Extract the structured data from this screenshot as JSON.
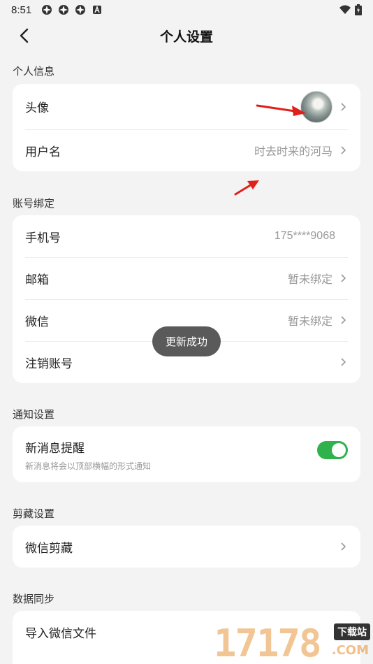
{
  "status_bar": {
    "time": "8:51",
    "icons": [
      "app-icon",
      "app-icon",
      "app-icon",
      "a-icon"
    ],
    "right_icons": [
      "wifi-icon",
      "battery-icon"
    ]
  },
  "nav": {
    "title": "个人设置",
    "back_icon": "chevron-left-icon"
  },
  "sections": {
    "personal": {
      "label": "个人信息",
      "avatar_label": "头像",
      "username_label": "用户名",
      "username_value": "时去时来的河马"
    },
    "account": {
      "label": "账号绑定",
      "phone_label": "手机号",
      "phone_value": "175****9068",
      "email_label": "邮箱",
      "email_value": "暂未绑定",
      "wechat_label": "微信",
      "wechat_value": "暂未绑定",
      "cancel_label": "注销账号"
    },
    "notify": {
      "label": "通知设置",
      "new_msg_label": "新消息提醒",
      "new_msg_sub": "新消息将会以顶部横幅的形式通知",
      "toggle_on": true
    },
    "clip": {
      "label": "剪藏设置",
      "wechat_clip_label": "微信剪藏"
    },
    "sync": {
      "label": "数据同步",
      "import_label": "导入微信文件"
    }
  },
  "toast": {
    "text": "更新成功"
  },
  "watermark": {
    "digits": "17178",
    "badge": "下载站",
    "suffix": ".COM"
  },
  "colors": {
    "accent_green": "#2fb24c",
    "background": "#f2f3f2",
    "annotation_red": "#e0201a"
  }
}
